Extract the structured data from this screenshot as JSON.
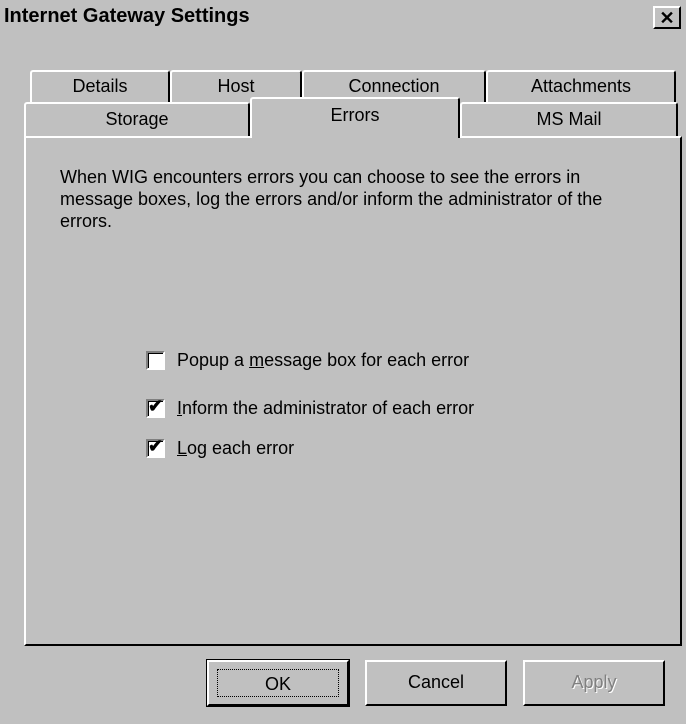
{
  "window": {
    "title": "Internet Gateway Settings",
    "close_glyph": "✕"
  },
  "tabs": {
    "row1": [
      "Details",
      "Host",
      "Connection",
      "Attachments"
    ],
    "row2": [
      "Storage",
      "Errors",
      "MS Mail"
    ],
    "active": "Errors"
  },
  "errors_panel": {
    "description": "When WIG encounters errors you can choose to see the errors in message boxes, log the errors and/or inform the administrator of the errors.",
    "options": [
      {
        "prefix": "Popup a ",
        "mnemonic": "m",
        "suffix": "essage box for each error",
        "checked": false
      },
      {
        "prefix": "",
        "mnemonic": "I",
        "suffix": "nform the administrator of each error",
        "checked": true
      },
      {
        "prefix": "",
        "mnemonic": "L",
        "suffix": "og each error",
        "checked": true
      }
    ]
  },
  "buttons": {
    "ok": "OK",
    "cancel": "Cancel",
    "apply": "Apply"
  },
  "icons": {
    "close": "close-icon",
    "check": "checkmark-icon"
  },
  "colors": {
    "face": "#c0c0c0",
    "highlight": "#ffffff",
    "shadow": "#808080",
    "dark": "#000000"
  }
}
